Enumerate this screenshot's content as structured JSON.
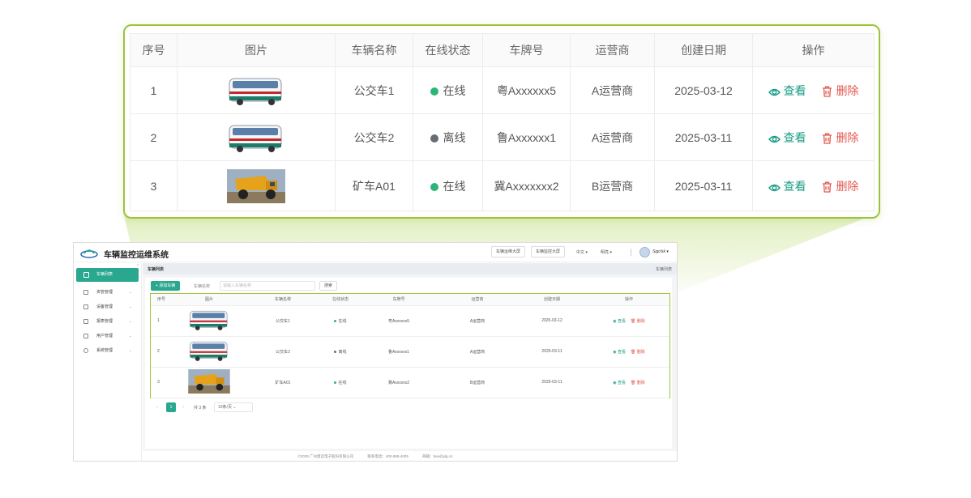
{
  "app": {
    "title": "车辆监控运维系统",
    "header_buttons": [
      "车辆运维大屏",
      "车辆监控大屏"
    ],
    "language": "中文",
    "theme": "明亮",
    "username": "Sigo'kk"
  },
  "sidebar": {
    "items": [
      {
        "label": "车辆列表",
        "icon": "bus-icon",
        "active": true
      },
      {
        "label": "资管管理",
        "icon": "asset-icon",
        "active": false
      },
      {
        "label": "设备管理",
        "icon": "device-icon",
        "active": false
      },
      {
        "label": "报表管理",
        "icon": "report-icon",
        "active": false
      },
      {
        "label": "用户管理",
        "icon": "user-icon",
        "active": false
      },
      {
        "label": "系统管理",
        "icon": "gear-icon",
        "active": false
      }
    ]
  },
  "page": {
    "title": "车辆列表",
    "breadcrumb": "车辆列表",
    "add_button": "+ 添加车辆",
    "filter_label": "车辆名称",
    "filter_placeholder": "请输入车辆名称",
    "search_button": "搜索"
  },
  "table": {
    "columns": [
      "序号",
      "图片",
      "车辆名称",
      "在线状态",
      "车牌号",
      "运营商",
      "创建日期",
      "操作"
    ],
    "rows": [
      {
        "index": "1",
        "image": "bus",
        "name": "公交车1",
        "status": "在线",
        "online": true,
        "plate": "粤Axxxxxx5",
        "operator": "A运营商",
        "date": "2025-03-12"
      },
      {
        "index": "2",
        "image": "bus",
        "name": "公交车2",
        "status": "离线",
        "online": false,
        "plate": "鲁Axxxxxx1",
        "operator": "A运营商",
        "date": "2025-03-11"
      },
      {
        "index": "3",
        "image": "truck",
        "name": "矿车A01",
        "status": "在线",
        "online": true,
        "plate": "冀Axxxxxxx2",
        "operator": "B运营商",
        "date": "2025-03-11"
      }
    ],
    "actions": {
      "view": "查看",
      "delete": "删除"
    },
    "mini_plates": [
      "粤Axxxxxx5",
      "鲁Axxxxxx1",
      "冀Axxxxxx2"
    ]
  },
  "pagination": {
    "current": "1",
    "total": "共 3 条",
    "page_size": "10条/页"
  },
  "footer": {
    "copyright": "©2025 广州意迈电子股份有限公司",
    "phone": "联系电话：400-888-4005",
    "email": "邮箱：bee@ylg.cn"
  },
  "colors": {
    "accent": "#2aa88f",
    "highlight_border": "#9cc43a",
    "online": "#2db577",
    "offline": "#666c74",
    "danger": "#e2574c"
  }
}
